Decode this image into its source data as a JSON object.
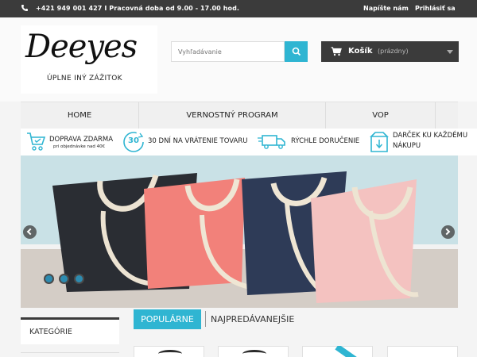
{
  "topbar": {
    "phone": "+421 949 001 427 I Pracovná doba od 9.00 - 17.00 hod.",
    "contact_link": "Napíšte nám",
    "login_link": "Prihlásiť sa",
    "phone_icon": "phone-icon"
  },
  "brand": {
    "logo_script": "Deeyes",
    "logo_tagline": "ÚPLNE INÝ  ZÁŽITOK"
  },
  "search": {
    "placeholder": "Vyhľadávanie",
    "icon": "search-icon"
  },
  "cart": {
    "label": "Košík",
    "status": "(prázdny)",
    "icon": "cart-icon"
  },
  "nav": {
    "items": [
      {
        "label": "HOME"
      },
      {
        "label": "VERNOSTNÝ PROGRAM"
      },
      {
        "label": "VOP"
      }
    ]
  },
  "benefits": [
    {
      "title": "DOPRAVA ZDARMA",
      "subtitle": "pri objednávke nad 40€",
      "icon": "cart-delivery-icon"
    },
    {
      "title": "30 DNÍ NA VRÁTENIE TOVARU",
      "badge": "30",
      "icon": "return-30-icon"
    },
    {
      "title": "RÝCHLE DORUČENIE",
      "icon": "truck-icon"
    },
    {
      "title": "DARČEK KU KAŽDÉMU",
      "title2": "NÁKUPU",
      "icon": "gift-download-icon"
    }
  ],
  "slider": {
    "dots": 3,
    "active_dot": 1
  },
  "sidebar": {
    "categories_title": "KATEGÓRIE"
  },
  "product_tabs": {
    "popular": "POPULÁRNE",
    "best_sellers": "NAJPREDÁVANEJŠIE"
  },
  "colors": {
    "accent": "#2fb5d2",
    "dark": "#3b3b3b"
  }
}
